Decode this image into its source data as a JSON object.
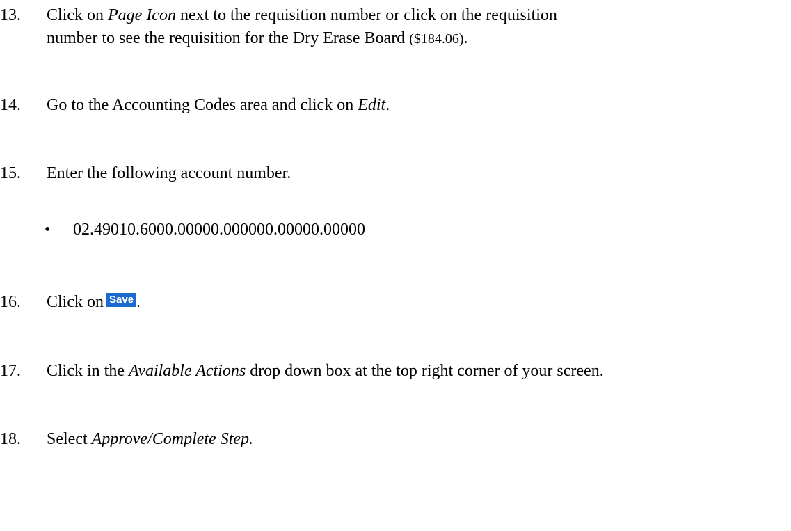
{
  "steps": [
    {
      "num": "13.",
      "pre": "Click on ",
      "em": "Page Icon",
      "post": " next to the requisition number or click on the requisition",
      "line2": "number to see the requisition for the Dry Erase Board ",
      "amount": "($184.06)",
      "end": "."
    },
    {
      "num": "14.",
      "pre": "Go to the Accounting Codes area and click on ",
      "em": "Edit",
      "post": "."
    },
    {
      "num": "15.",
      "text": "Enter the following account number.",
      "bullet": "•",
      "account": "02.49010.6000.00000.000000.00000.00000"
    },
    {
      "num": "16.",
      "pre": "Click on",
      "button": "Save",
      "post": "."
    },
    {
      "num": "17.",
      "pre": "Click in the ",
      "em": "Available Actions",
      "post": " drop down box at the top right corner of your screen."
    },
    {
      "num": "18.",
      "pre": "Select ",
      "em": "Approve/Complete Step."
    }
  ]
}
